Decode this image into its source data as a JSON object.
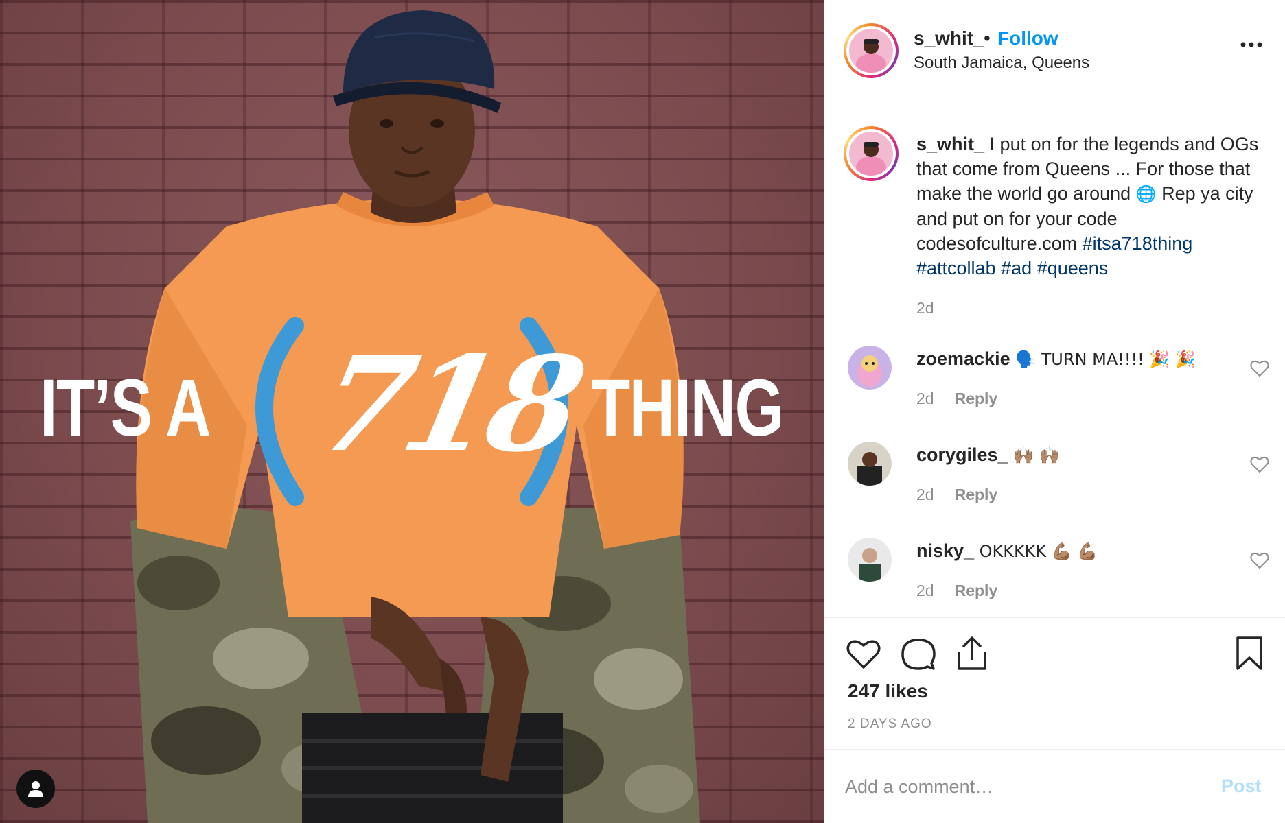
{
  "post": {
    "username": "s_whit_",
    "dot": "•",
    "follow_label": "Follow",
    "location": "South Jamaica, Queens",
    "overlay": {
      "left": "IT’S A",
      "number": "718",
      "right": "THING"
    }
  },
  "caption": {
    "username": "s_whit_",
    "text_1": " I put on for the legends and OGs that come from Queens ... For those that make the world go around ",
    "globe": "🌐",
    "text_2": "  Rep ya city and put on for your code codesofculture.com ",
    "hashtags": [
      "#itsa718thing",
      "#attcollab",
      "#ad",
      "#queens"
    ],
    "time": "2d"
  },
  "comments": [
    {
      "username": "zoemackie",
      "text": "🗣️  TURN MA!!!! 🎉 🎉",
      "time": "2d",
      "reply_label": "Reply"
    },
    {
      "username": "corygiles_",
      "text": "🙌🏽 🙌🏽",
      "time": "2d",
      "reply_label": "Reply"
    },
    {
      "username": "nisky_",
      "text": "OKKKKK 💪🏽 💪🏽",
      "time": "2d",
      "reply_label": "Reply"
    }
  ],
  "actions": {
    "likes": "247 likes",
    "ago": "2 DAYS AGO"
  },
  "add_comment": {
    "placeholder": "Add a comment…",
    "post_label": "Post"
  },
  "colors": {
    "link_blue": "#0095f6",
    "hashtag_blue": "#00376b",
    "post_disabled": "#b2dffc",
    "overlay_paren_blue": "#3d9ad6",
    "brick_wall": "#7d4b4e",
    "sweater_orange": "#f59a52"
  },
  "icons": {
    "more": "more-options-icon",
    "heart": "heart-icon",
    "comment": "comment-icon",
    "share": "share-icon",
    "save": "bookmark-icon",
    "user": "user-icon"
  }
}
